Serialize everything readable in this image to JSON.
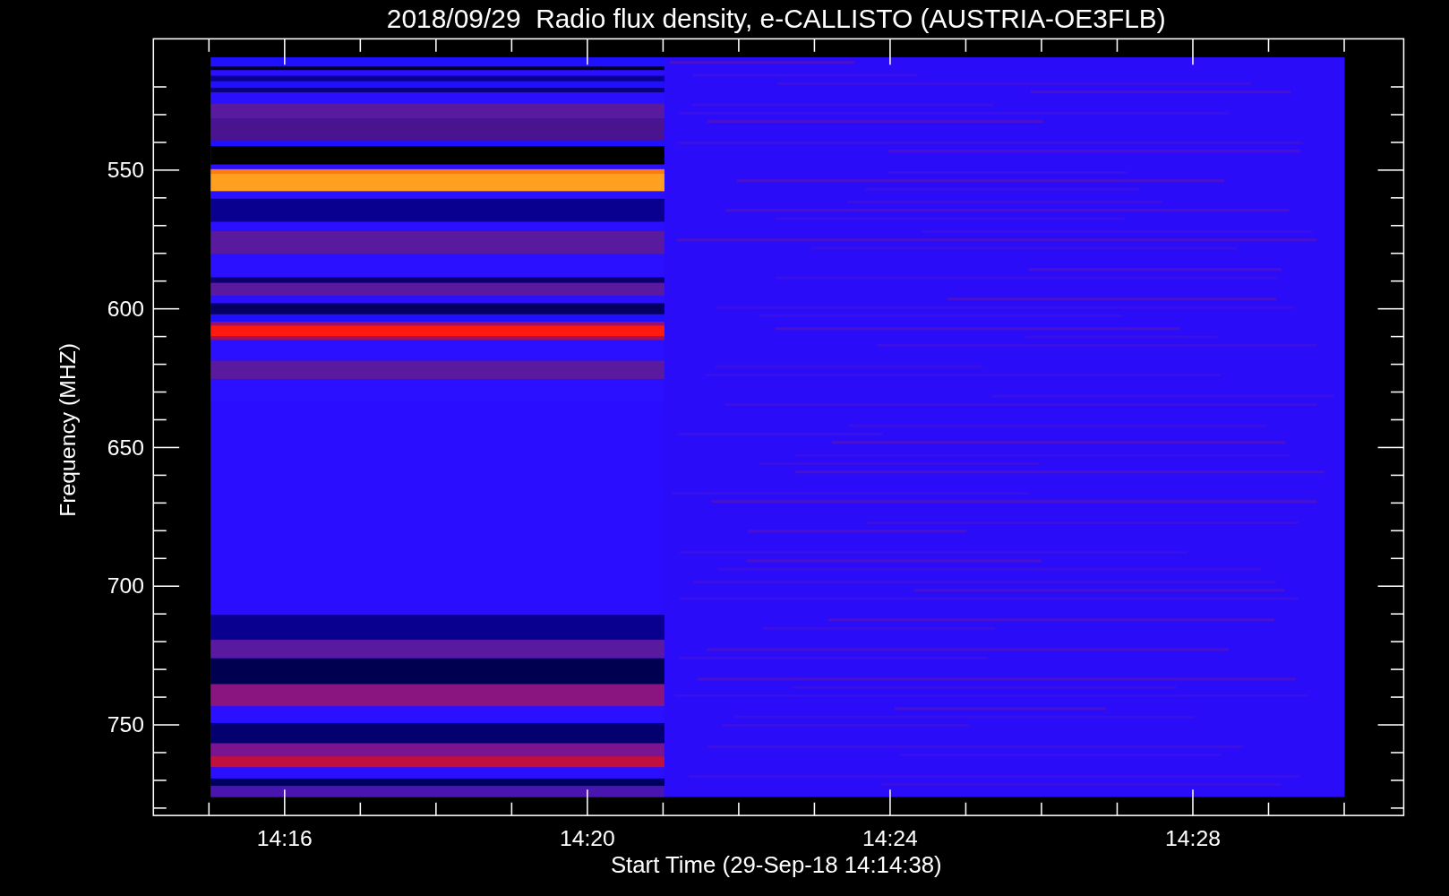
{
  "plot": {
    "title": "2018/09/29  Radio flux density, e-CALLISTO (AUSTRIA-OE3FLB)",
    "y_axis": {
      "label": "Frequency (MHZ)",
      "ticks": [
        "550",
        "600",
        "650",
        "700",
        "750"
      ]
    },
    "x_axis": {
      "label": "Start Time (29-Sep-18 14:14:38)",
      "ticks": [
        "14:16",
        "14:20",
        "14:24",
        "14:28"
      ]
    }
  }
}
